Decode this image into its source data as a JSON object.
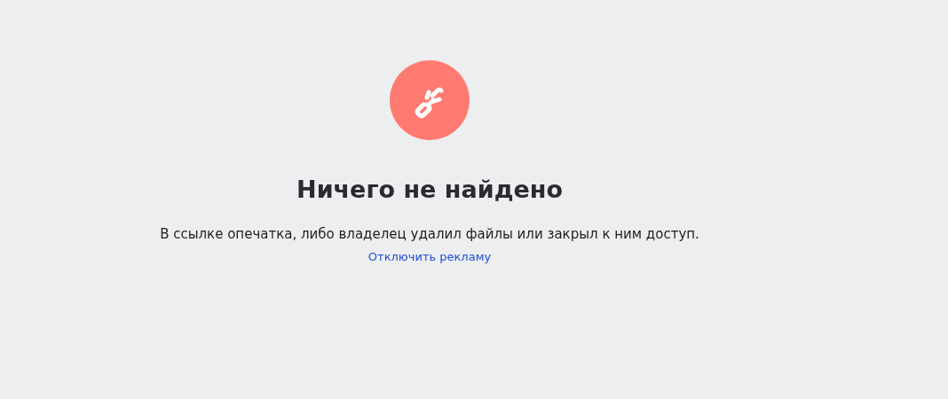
{
  "title": "Ничего не найдено",
  "message": "В ссылке опечатка, либо владелец удалил файлы или закрыл к ним доступ.",
  "link": "Отключить рекламу"
}
